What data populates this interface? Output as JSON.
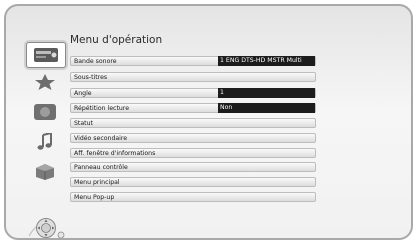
{
  "menu": {
    "title": "Menu d'opération",
    "items": [
      {
        "label": "Bande sonore",
        "value": "1 ENG DTS-HD MSTR Multi"
      },
      {
        "label": "Sous-titres"
      },
      {
        "label": "Angle",
        "value": "1"
      },
      {
        "label": "Répétition lecture",
        "value": "Non"
      },
      {
        "label": "Statut"
      },
      {
        "label": "Vidéo secondaire"
      },
      {
        "label": "Aff. fenêtre d'informations"
      },
      {
        "label": "Panneau contrôle"
      },
      {
        "label": "Menu principal"
      },
      {
        "label": "Menu Pop-up"
      }
    ]
  },
  "sidebar": {
    "icons": [
      "disc-player-icon",
      "star-icon",
      "image-icon",
      "music-note-icon",
      "cube-icon",
      "box-icon"
    ]
  },
  "colors": {
    "value_bg": "#1c1c1c",
    "row_bg": "#e8e8e8"
  }
}
